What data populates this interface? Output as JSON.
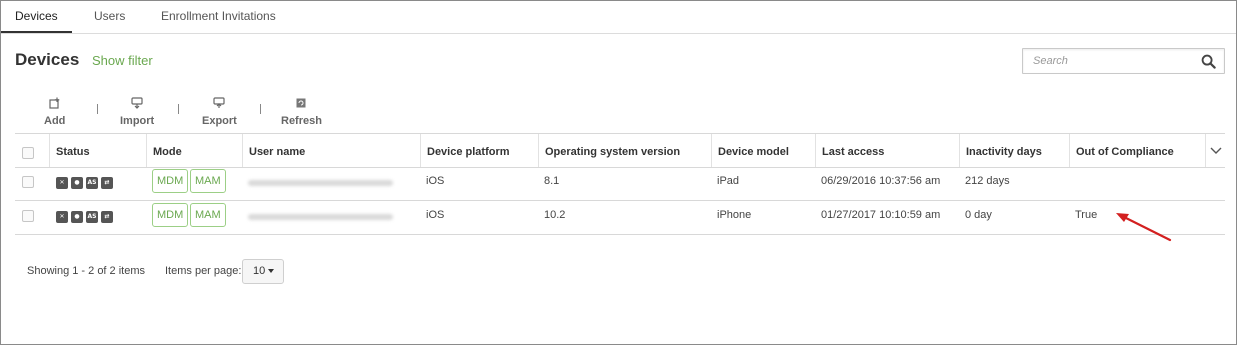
{
  "tabs": [
    {
      "label": "Devices",
      "active": true
    },
    {
      "label": "Users",
      "active": false
    },
    {
      "label": "Enrollment Invitations",
      "active": false
    }
  ],
  "header": {
    "title": "Devices",
    "show_filter": "Show filter",
    "search_placeholder": "Search"
  },
  "toolbar": {
    "add": "Add",
    "import": "Import",
    "export": "Export",
    "refresh": "Refresh"
  },
  "table": {
    "columns": [
      "Status",
      "Mode",
      "User name",
      "Device platform",
      "Operating system version",
      "Device model",
      "Last access",
      "Inactivity days",
      "Out of Compliance"
    ],
    "rows": [
      {
        "status_icons": [
          "✕",
          "●",
          "AS",
          "⇄"
        ],
        "modes": [
          "MDM",
          "MAM"
        ],
        "platform": "iOS",
        "os_version": "8.1",
        "model": "iPad",
        "last_access": "06/29/2016 10:37:56 am",
        "inactivity": "212 days",
        "compliance": ""
      },
      {
        "status_icons": [
          "✕",
          "●",
          "AS",
          "⇄"
        ],
        "modes": [
          "MDM",
          "MAM"
        ],
        "platform": "iOS",
        "os_version": "10.2",
        "model": "iPhone",
        "last_access": "01/27/2017 10:10:59 am",
        "inactivity": "0 day",
        "compliance": "True"
      }
    ]
  },
  "footer": {
    "showing": "Showing 1 - 2 of 2 items",
    "items_per_page_label": "Items per page:",
    "items_per_page_value": "10"
  },
  "colors": {
    "accent_green": "#6aa84f",
    "annotation_arrow": "#d32020"
  }
}
